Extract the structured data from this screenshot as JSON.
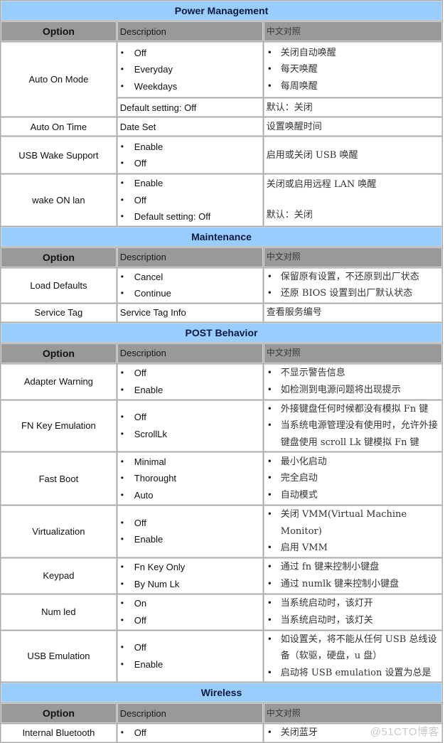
{
  "column_headers": {
    "option": "Option",
    "description": "Description",
    "chinese": "中文对照"
  },
  "sections": [
    {
      "title": "Power Management",
      "rows": [
        {
          "option": "Auto On Mode",
          "desc_list": [
            "Off",
            "Everyday",
            "Weekdays"
          ],
          "cn_list": [
            "关闭自动唤醒",
            "每天唤醒",
            "每周唤醒"
          ],
          "sub": {
            "desc": "Default setting: Off",
            "cn": "默认：关闭"
          }
        },
        {
          "option": "Auto On Time",
          "desc_text": "Date Set",
          "cn_text": "设置唤醒时间"
        },
        {
          "option": "USB Wake Support",
          "desc_list": [
            "Enable",
            "Off"
          ],
          "cn_text": "启用或关闭  USB  唤醒"
        },
        {
          "option": "wake ON lan",
          "desc_list": [
            "Enable",
            "Off",
            "Default setting: Off"
          ],
          "cn_paras": [
            "关闭或启用远程 LAN 唤醒",
            "默认：关闭"
          ]
        }
      ]
    },
    {
      "title": "Maintenance",
      "rows": [
        {
          "option": "Load Defaults",
          "desc_list": [
            "Cancel",
            "Continue"
          ],
          "cn_list": [
            "保留原有设置，不还原到出厂状态",
            "还原 BIOS 设置到出厂默认状态"
          ]
        },
        {
          "option": "Service Tag",
          "desc_text": "Service Tag Info",
          "cn_text": "查看服务编号"
        }
      ]
    },
    {
      "title": "POST Behavior",
      "rows": [
        {
          "option": "Adapter Warning",
          "desc_list": [
            "Off",
            "Enable"
          ],
          "cn_list": [
            "不显示警告信息",
            "如检测到电源问题将出现提示"
          ]
        },
        {
          "option": "FN Key Emulation",
          "desc_list": [
            "Off",
            "ScrollLk"
          ],
          "cn_list": [
            "外接键盘任何时候都没有模拟 Fn 键",
            "当系统电源管理没有使用时，允许外接键盘使用 scroll Lk 键模拟 Fn  键"
          ]
        },
        {
          "option": "Fast Boot",
          "desc_list": [
            "Minimal",
            "Thorought",
            "Auto"
          ],
          "cn_list": [
            "最小化启动",
            "完全启动",
            "自动模式"
          ]
        },
        {
          "option": "Virtualization",
          "desc_list": [
            "Off",
            "Enable"
          ],
          "cn_list": [
            "关闭 VMM(Virtual Machine Monitor)",
            "启用 VMM"
          ]
        },
        {
          "option": "Keypad",
          "desc_list": [
            "Fn Key Only",
            "By Num Lk"
          ],
          "cn_list": [
            "通过 fn 键来控制小键盘",
            "通过 numlk 键来控制小键盘"
          ]
        },
        {
          "option": "Num led",
          "desc_list": [
            "On",
            "Off"
          ],
          "cn_list": [
            "当系统启动时，该灯开",
            "当系统启动时，该灯关"
          ]
        },
        {
          "option": "USB Emulation",
          "desc_list": [
            "Off",
            "Enable"
          ],
          "cn_list": [
            "如设置关，将不能从任何 USB 总线设备（软驱，硬盘，u 盘）",
            "启动将 USB emulation 设置为总是"
          ]
        }
      ]
    },
    {
      "title": "Wireless",
      "rows": [
        {
          "option": "Internal Bluetooth",
          "desc_list": [
            "Off"
          ],
          "cn_list": [
            "关闭蓝牙"
          ]
        }
      ]
    }
  ],
  "watermark": "@51CTO博客",
  "colors": {
    "section_header_bg": "#99ccff",
    "column_header_bg": "#999999",
    "grid": "#a8a8a8"
  }
}
